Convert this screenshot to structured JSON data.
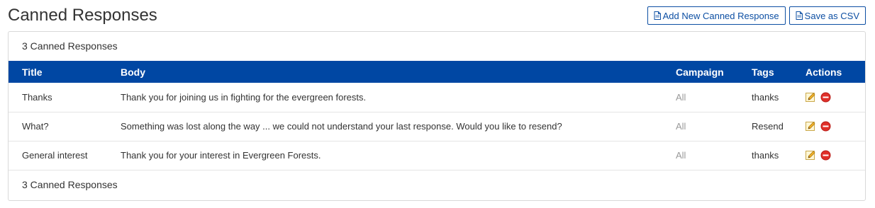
{
  "header": {
    "title": "Canned Responses",
    "add_button": "Add New Canned Response",
    "csv_button": "Save as CSV"
  },
  "summary_top": "3 Canned Responses",
  "summary_bottom": "3 Canned Responses",
  "table": {
    "columns": [
      "Title",
      "Body",
      "Campaign",
      "Tags",
      "Actions"
    ],
    "rows": [
      {
        "title": "Thanks",
        "body": "Thank you for joining us in fighting for the evergreen forests.",
        "campaign": "All",
        "tags": "thanks"
      },
      {
        "title": "What?",
        "body": "Something was lost along the way ... we could not understand your last response. Would you like to resend?",
        "campaign": "All",
        "tags": "Resend"
      },
      {
        "title": "General interest",
        "body": "Thank you for your interest in Evergreen Forests.",
        "campaign": "All",
        "tags": "thanks"
      }
    ]
  },
  "icons": {
    "edit": "pencil-icon",
    "delete": "minus-circle-icon",
    "doc": "document-icon"
  },
  "colors": {
    "header_bg": "#0047a3",
    "button_border": "#0d4fa3",
    "delete_red": "#e0302a",
    "muted_text": "#999999"
  }
}
